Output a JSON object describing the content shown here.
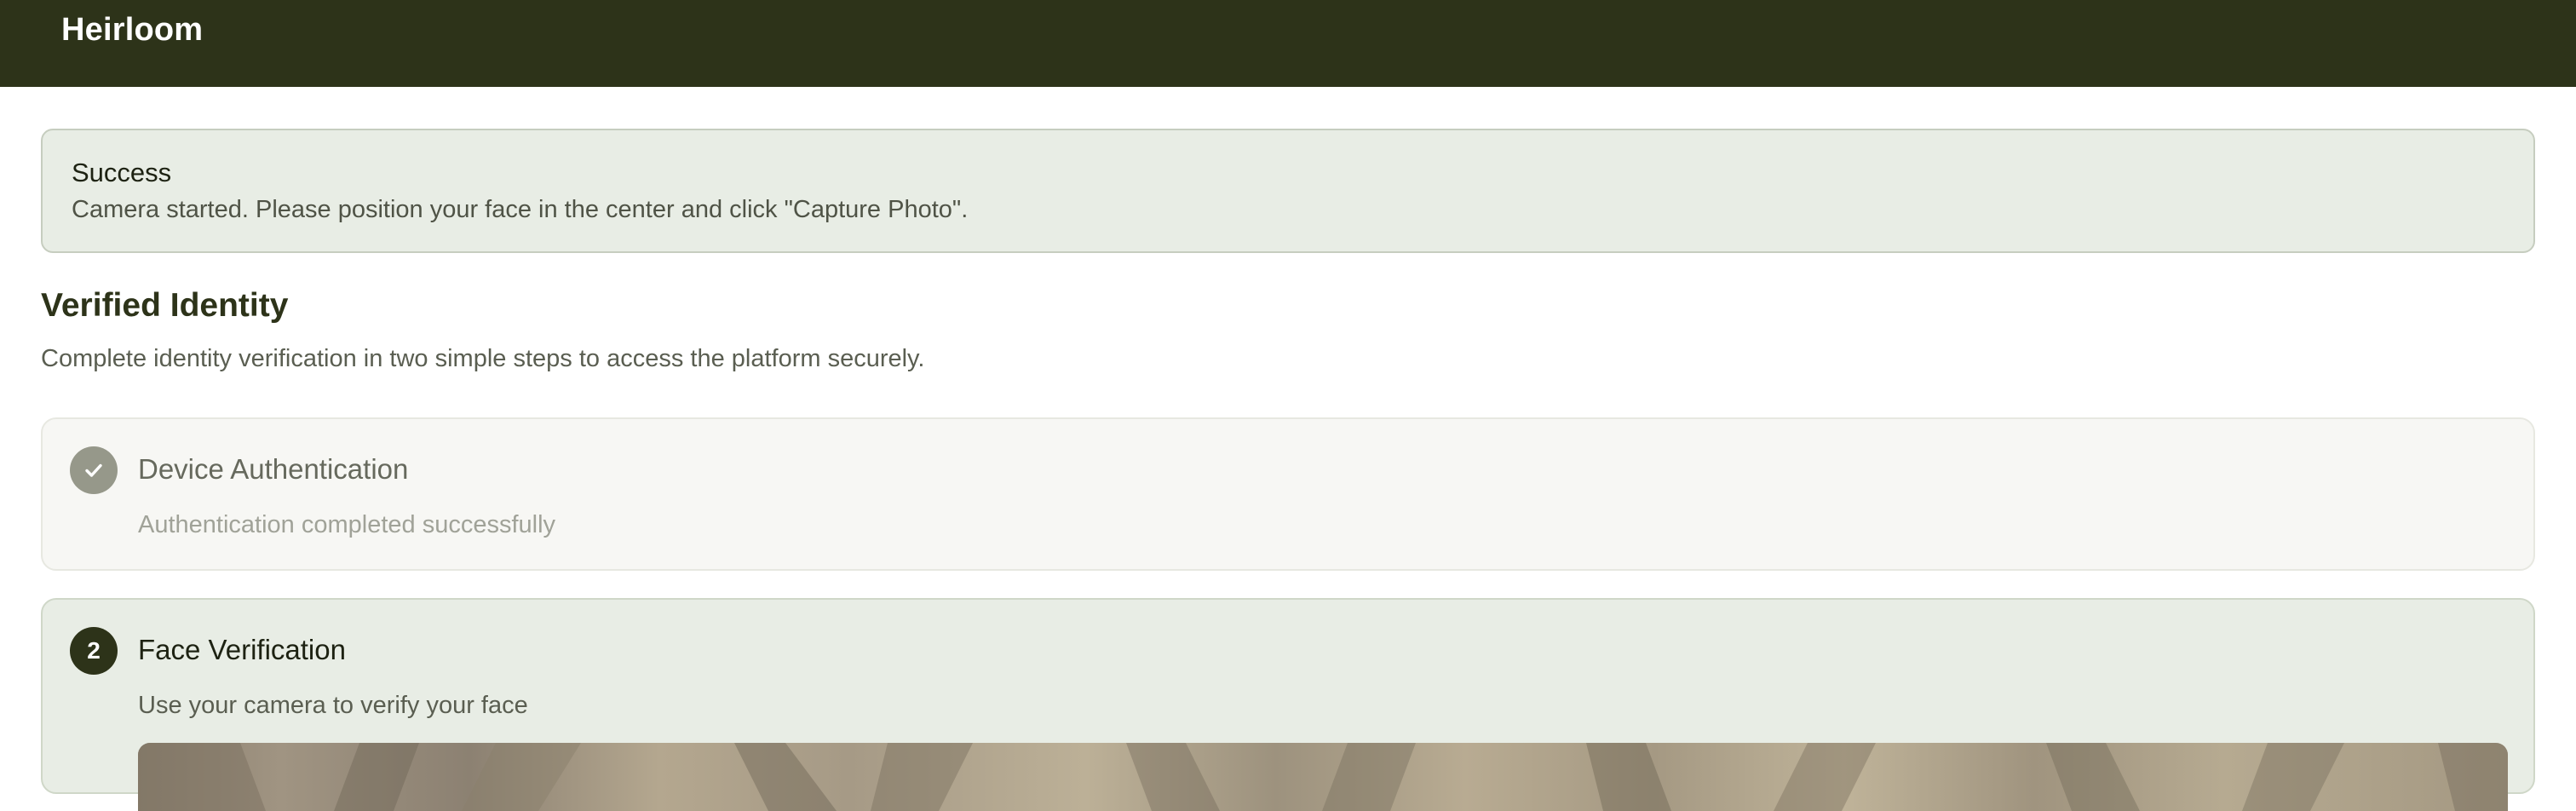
{
  "app": {
    "brand": "Heirloom"
  },
  "alert": {
    "title": "Success",
    "message": "Camera started. Please position your face in the center and click \"Capture Photo\"."
  },
  "page": {
    "title": "Verified Identity",
    "subtitle": "Complete identity verification in two simple steps to access the platform securely."
  },
  "steps": [
    {
      "badge": "",
      "status": "completed",
      "title": "Device Authentication",
      "description": "Authentication completed successfully"
    },
    {
      "badge": "2",
      "status": "active",
      "title": "Face Verification",
      "description": "Use your camera to verify your face"
    }
  ],
  "colors": {
    "header_bg": "#2d3319",
    "alert_bg": "#e8ede5",
    "completed_badge": "#96988a",
    "active_badge": "#2d3319"
  },
  "icons": {
    "completed_step": "check-icon"
  }
}
